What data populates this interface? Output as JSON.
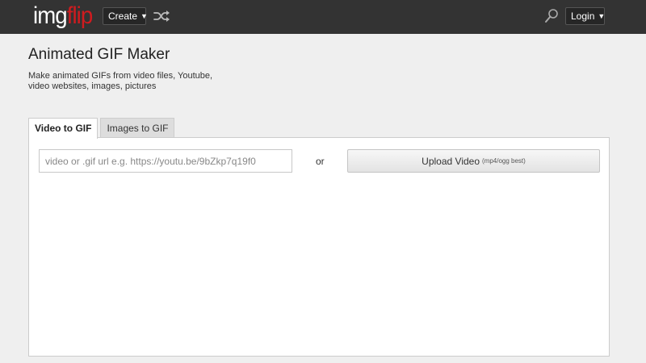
{
  "header": {
    "logo_img": "img",
    "logo_flip": "flip",
    "create_label": "Create",
    "login_label": "Login",
    "icons": [
      "shuffle-icon",
      "search-icon",
      "caret-down-icon"
    ],
    "brand_color": "#d01b1f",
    "bar_color": "#333333"
  },
  "page": {
    "title": "Animated GIF Maker",
    "description_line1": "Make animated GIFs from video files, Youtube,",
    "description_line2": "video websites, images, pictures"
  },
  "tabs": [
    {
      "label": "Video to GIF",
      "active": true
    },
    {
      "label": "Images to GIF",
      "active": false
    }
  ],
  "video_panel": {
    "url_input_placeholder": "video or .gif url e.g. https://youtu.be/9bZkp7q19f0",
    "url_input_value": "",
    "or_text": "or",
    "upload_label": "Upload Video",
    "upload_hint": "(mp4/ogg best)"
  }
}
